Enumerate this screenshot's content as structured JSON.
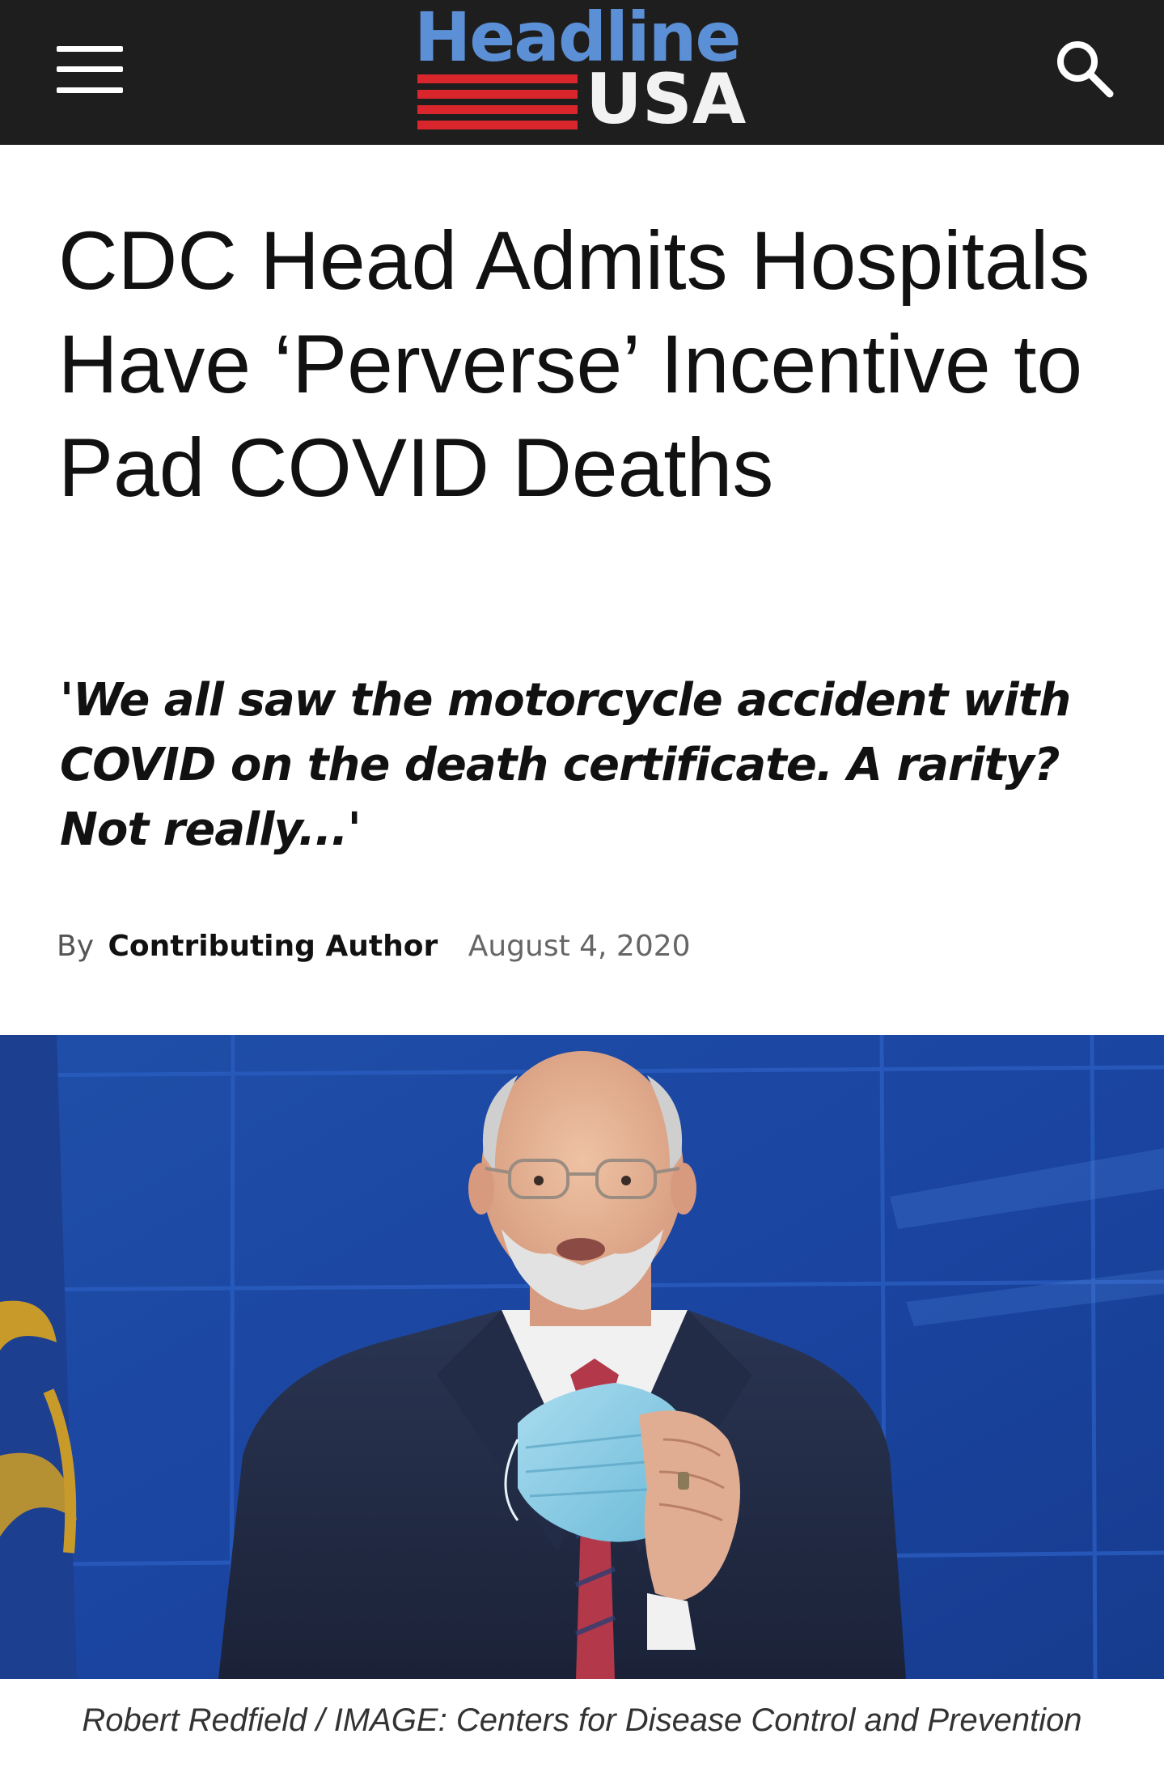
{
  "header": {
    "logo_top": "Headline",
    "logo_bottom": "USA",
    "menu_icon": "hamburger-icon",
    "search_icon": "search-icon",
    "bar_color": "#1e1e1e",
    "logo_blue": "#5b8fd6",
    "logo_red": "#d8262c"
  },
  "article": {
    "headline": "CDC Head Admits Hospitals Have ‘Perverse’ Incentive to Pad COVID Deaths",
    "subhead": "'We all saw the motorcycle accident with COVID on the death certificate. A rarity? Not really...'",
    "byline_prefix": "By",
    "author": "Contributing Author",
    "date": "August 4, 2020",
    "image_caption": "Robert Redfield / IMAGE: Centers for Disease Control and Prevention"
  }
}
